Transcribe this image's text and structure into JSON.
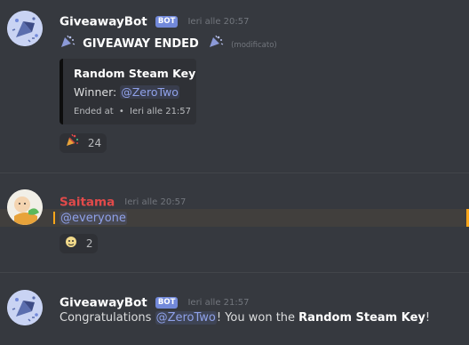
{
  "messages": [
    {
      "author": "GiveawayBot",
      "bot_tag": "BOT",
      "timestamp": "Ieri alle 20:57",
      "title_text": "GIVEAWAY ENDED",
      "edited": "(modificato)",
      "embed": {
        "title": "Random Steam Key",
        "winner_label": "Winner:",
        "winner_mention": "@ZeroTwo",
        "footer_label": "Ended at",
        "footer_sep": "•",
        "footer_time": "Ieri alle 21:57"
      },
      "reaction": {
        "icon": "party-popper-icon",
        "count": "24"
      }
    },
    {
      "author": "Saitama",
      "timestamp": "Ieri alle 20:57",
      "mention": "@everyone",
      "reaction": {
        "icon": "ghost-emoji-icon",
        "count": "2"
      }
    },
    {
      "author": "GiveawayBot",
      "bot_tag": "BOT",
      "timestamp": "Ieri alle 21:57",
      "text_prefix": "Congratulations ",
      "mention": "@ZeroTwo",
      "text_middle": "! You won the ",
      "prize": "Random Steam Key",
      "text_suffix": "!"
    }
  ],
  "colors": {
    "background": "#36393f",
    "mention": "#8fa1e9",
    "bot_tag": "#7289da",
    "saitama_name": "#e24a4a",
    "highlight": "#faa61a"
  }
}
